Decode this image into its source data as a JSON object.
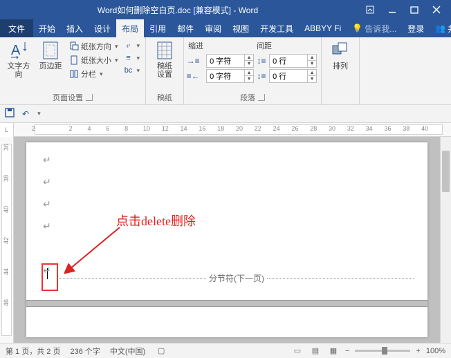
{
  "titlebar": {
    "title": "Word如何删除空白页.doc [兼容模式] - Word"
  },
  "tabs": {
    "file": "文件",
    "items": [
      "开始",
      "插入",
      "设计",
      "布局",
      "引用",
      "邮件",
      "审阅",
      "视图",
      "开发工具",
      "ABBYY Fi"
    ],
    "active_index": 3,
    "tell_me": "告诉我...",
    "login": "登录",
    "share": "共享"
  },
  "ribbon": {
    "text_direction": "文字方向",
    "margins": "页边距",
    "orientation": "纸张方向",
    "size": "纸张大小",
    "columns": "分栏",
    "page_setup_label": "页面设置",
    "draft_settings": "稿纸\n设置",
    "draft_label": "稿纸",
    "indent_header": "缩进",
    "spacing_header": "间距",
    "indent_left": "0 字符",
    "indent_right": "0 字符",
    "space_before": "0 行",
    "space_after": "0 行",
    "paragraph_label": "段落",
    "arrange": "排列",
    "arrange_label": ""
  },
  "ruler": {
    "ticks": [
      "2",
      "",
      "2",
      "4",
      "6",
      "8",
      "10",
      "12",
      "14",
      "16",
      "18",
      "20",
      "22",
      "24",
      "26",
      "28",
      "30",
      "32",
      "34",
      "36",
      "38",
      "40"
    ]
  },
  "v_ruler": {
    "ticks": [
      "36",
      "38",
      "40",
      "42",
      "44",
      "46"
    ]
  },
  "document": {
    "callout": "点击delete删除",
    "section_break": "分节符(下一页)"
  },
  "statusbar": {
    "page": "第 1 页，共 2 页",
    "words": "236 个字",
    "language": "中文(中国)",
    "zoom": "100%"
  }
}
